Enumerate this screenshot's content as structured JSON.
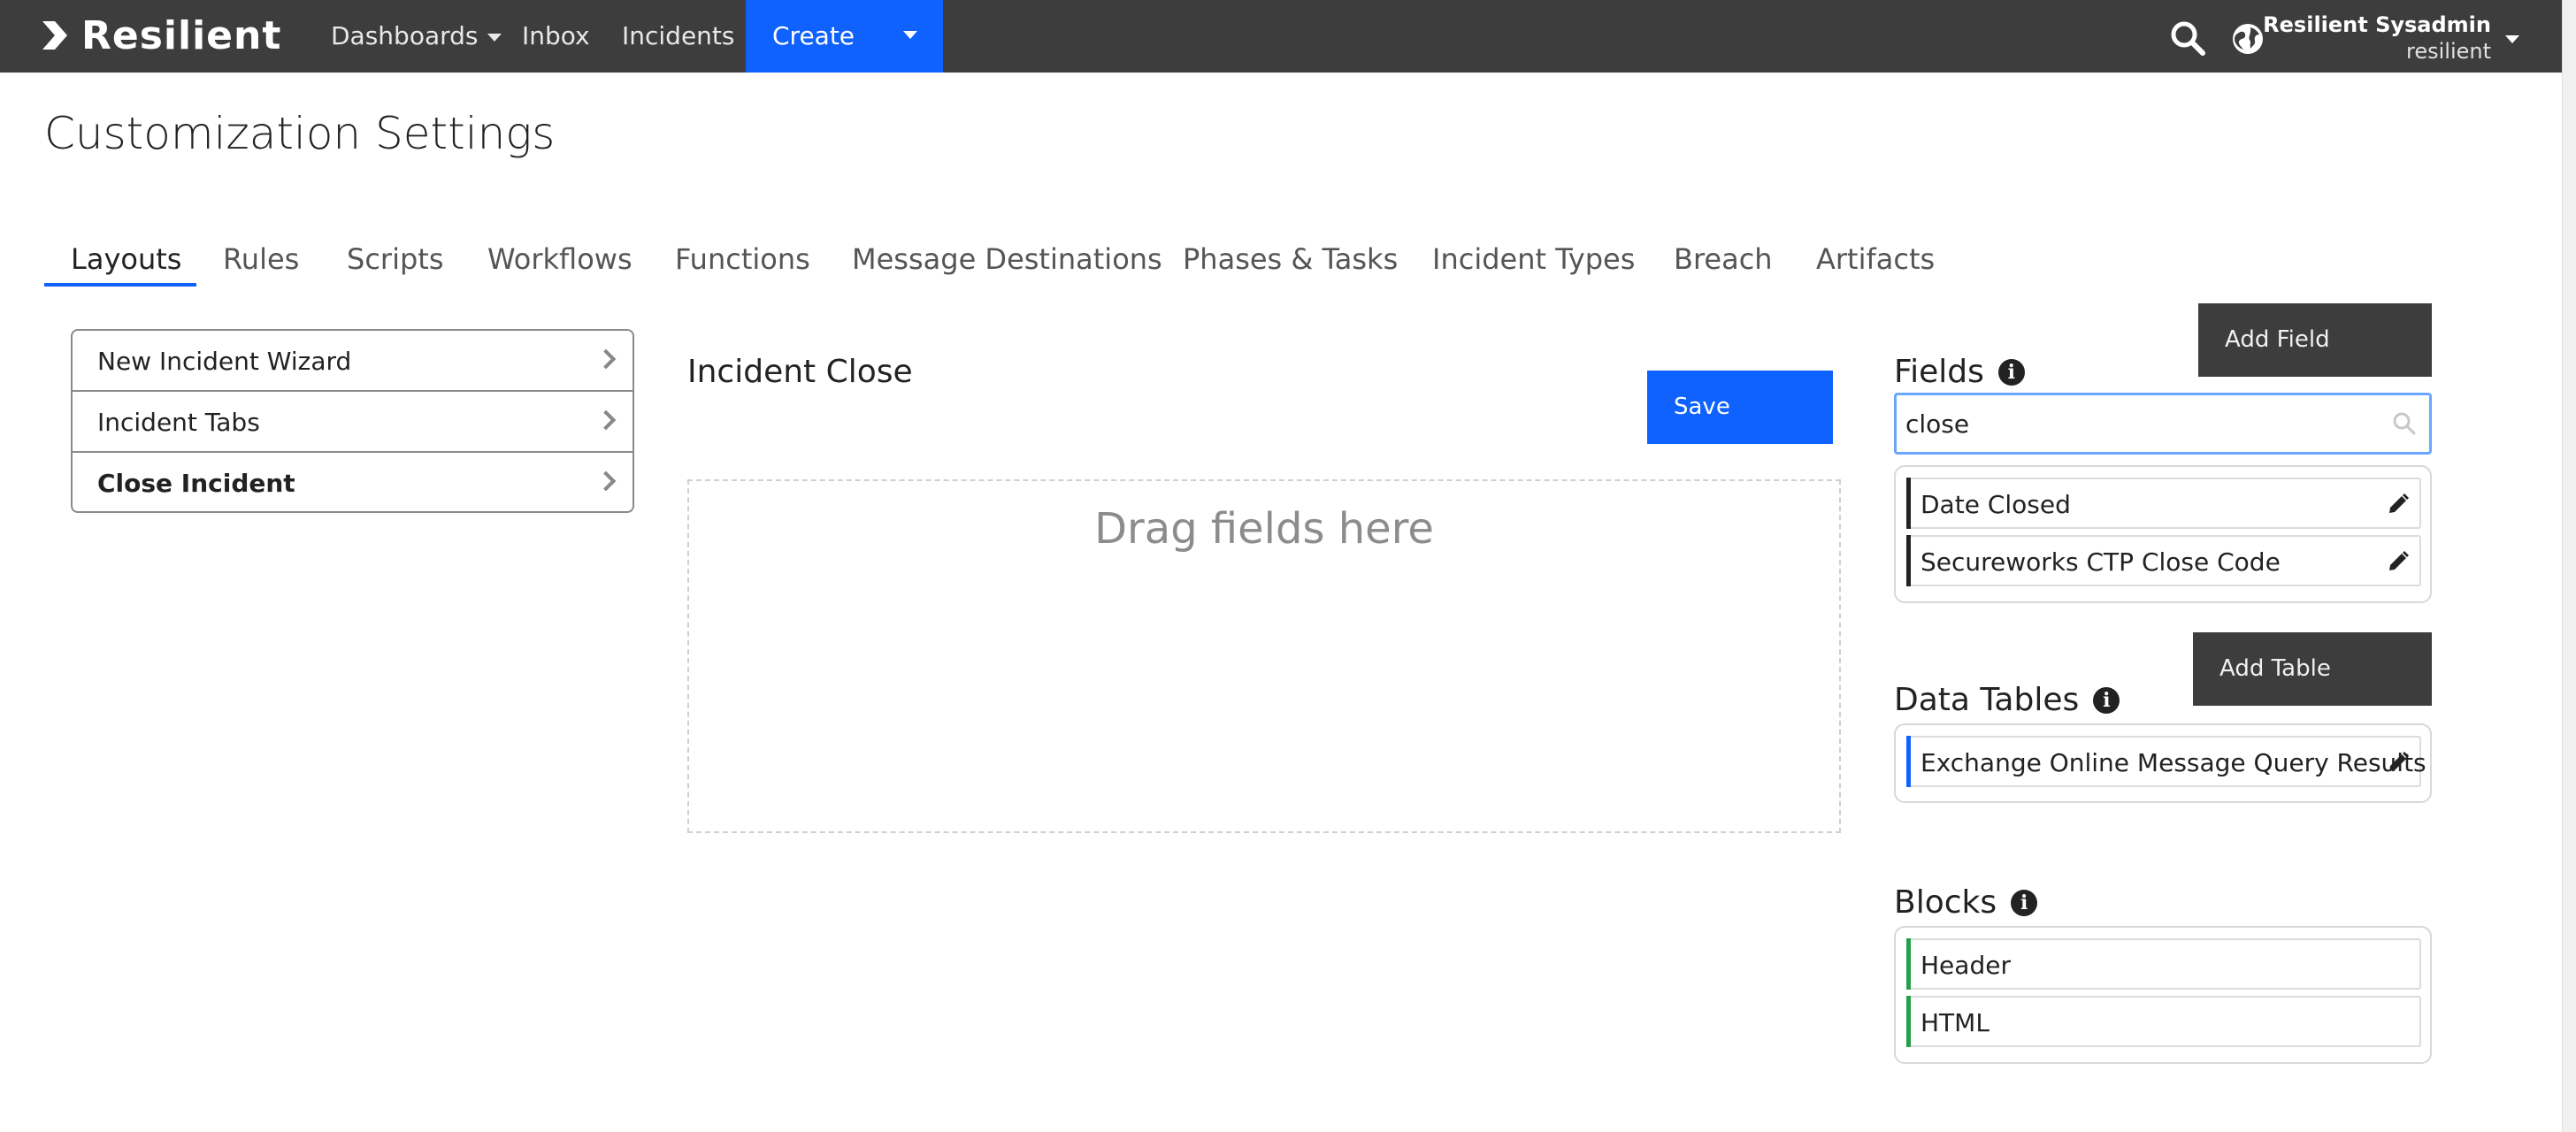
{
  "brand": {
    "name": "Resilient"
  },
  "nav": {
    "items": [
      {
        "label": "Dashboards",
        "has_caret": true
      },
      {
        "label": "Inbox"
      },
      {
        "label": "Incidents"
      }
    ],
    "create_label": "Create",
    "user": {
      "name": "Resilient Sysadmin",
      "org": "resilient"
    },
    "icons": [
      "search-icon",
      "globe-icon"
    ]
  },
  "page": {
    "title": "Customization Settings"
  },
  "tabs": [
    {
      "label": "Layouts",
      "active": true
    },
    {
      "label": "Rules"
    },
    {
      "label": "Scripts"
    },
    {
      "label": "Workflows"
    },
    {
      "label": "Functions"
    },
    {
      "label": "Message Destinations"
    },
    {
      "label": "Phases & Tasks"
    },
    {
      "label": "Incident Types"
    },
    {
      "label": "Breach"
    },
    {
      "label": "Artifacts"
    }
  ],
  "layouts": [
    {
      "label": "New Incident Wizard",
      "selected": false
    },
    {
      "label": "Incident Tabs",
      "selected": false
    },
    {
      "label": "Close Incident",
      "selected": true
    }
  ],
  "editor": {
    "title": "Incident Close",
    "save_label": "Save",
    "drop_text": "Drag fields here"
  },
  "fields": {
    "title": "Fields",
    "add_label": "Add Field",
    "search_value": "close",
    "items": [
      {
        "label": "Date Closed"
      },
      {
        "label": "Secureworks CTP Close Code"
      }
    ]
  },
  "data_tables": {
    "title": "Data Tables",
    "add_label": "Add Table",
    "items": [
      {
        "label": "Exchange Online Message Query Results"
      }
    ]
  },
  "blocks": {
    "title": "Blocks",
    "items": [
      {
        "label": "Header"
      },
      {
        "label": "HTML"
      }
    ]
  },
  "colors": {
    "nav_bg": "#3d3d3d",
    "accent": "#0f62fe",
    "field_bar": "#222222",
    "table_bar": "#0f62fe",
    "block_bar": "#24a148"
  }
}
